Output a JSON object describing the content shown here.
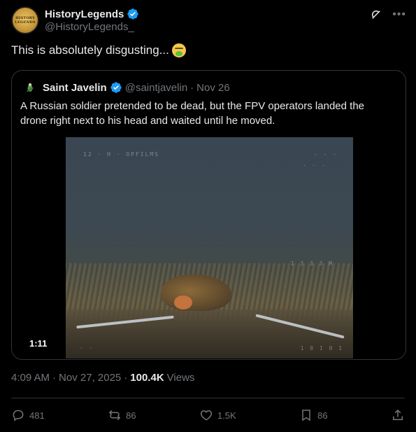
{
  "author": {
    "display_name": "HistoryLegends",
    "handle": "@HistoryLegends_",
    "avatar_text": "HISTORY LEGENDS"
  },
  "tweet": {
    "text": "This is absolutely disgusting...",
    "emoji": "nauseated-face"
  },
  "quote": {
    "display_name": "Saint Javelin",
    "handle": "@saintjavelin",
    "separator": "·",
    "date": "Nov 26",
    "text": "A Russian soldier pretended to be dead, but the FPV operators landed the drone right next to his head and waited until he moved.",
    "video": {
      "duration": "1:11",
      "osd_top_left": "12 · H · OPFILMS",
      "osd_top_right_1": "- - -",
      "osd_top_right_2": "· · ·",
      "osd_mid_right": "1 3 3 3 M",
      "osd_bottom_right": "1 0 1 0 1",
      "osd_bottom_left": "· ·"
    }
  },
  "meta": {
    "time": "4:09 AM",
    "separator": "·",
    "date": "Nov 27, 2025",
    "separator2": "·",
    "views_count": "100.4K",
    "views_label": "Views"
  },
  "actions": {
    "replies": "481",
    "reposts": "86",
    "likes": "1.5K",
    "bookmarks": "86"
  },
  "colors": {
    "background": "#000000",
    "text": "#e7e9ea",
    "secondary": "#71767b",
    "border": "#2f3336",
    "verified": "#1d9bf0"
  }
}
